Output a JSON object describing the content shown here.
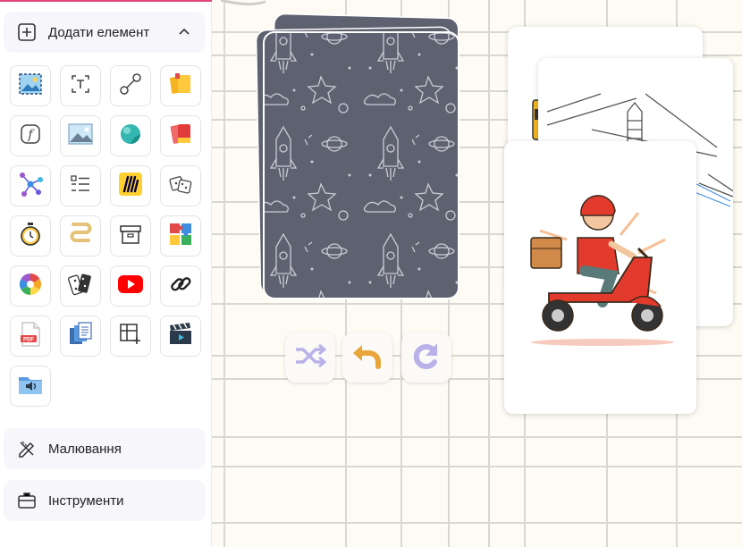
{
  "sidebar": {
    "add_element": {
      "label": "Додати елемент",
      "icon": "plus-square-icon",
      "expanded": true
    },
    "tools": [
      {
        "icon": "image-frame-icon"
      },
      {
        "icon": "text-box-icon"
      },
      {
        "icon": "connector-line-icon"
      },
      {
        "icon": "sticky-notes-icon"
      },
      {
        "icon": "formula-icon"
      },
      {
        "icon": "image-icon"
      },
      {
        "icon": "sphere-icon"
      },
      {
        "icon": "red-cards-icon"
      },
      {
        "icon": "mind-map-icon"
      },
      {
        "icon": "checklist-icon"
      },
      {
        "icon": "miro-logo-icon"
      },
      {
        "icon": "dice-icon"
      },
      {
        "icon": "timer-icon"
      },
      {
        "icon": "path-icon"
      },
      {
        "icon": "archive-box-icon"
      },
      {
        "icon": "puzzle-icon"
      },
      {
        "icon": "color-wheel-icon"
      },
      {
        "icon": "dominoes-icon"
      },
      {
        "icon": "youtube-icon"
      },
      {
        "icon": "link-icon"
      },
      {
        "icon": "pdf-icon"
      },
      {
        "icon": "documents-stack-icon"
      },
      {
        "icon": "table-add-icon"
      },
      {
        "icon": "clapperboard-icon"
      },
      {
        "icon": "audio-folder-icon"
      }
    ],
    "drawing": {
      "label": "Малювання",
      "icon": "pencil-ruler-icon"
    },
    "instruments": {
      "label": "Інструменти",
      "icon": "briefcase-icon"
    }
  },
  "canvas": {
    "deck": {
      "pattern": "rocket-space-doodle",
      "color": "#5e6170"
    },
    "controls": [
      {
        "icon": "shuffle-icon"
      },
      {
        "icon": "undo-arrow-icon"
      },
      {
        "icon": "redo-rotate-icon"
      }
    ],
    "cards": [
      {
        "icon": "vehicle-partial-icon"
      },
      {
        "icon": "power-line-sketch-icon"
      },
      {
        "icon": "delivery-scooter-illustration"
      }
    ]
  },
  "colors": {
    "accent": "#e0457b",
    "grid": "#d9d7d1",
    "background": "#fdfbf3"
  }
}
